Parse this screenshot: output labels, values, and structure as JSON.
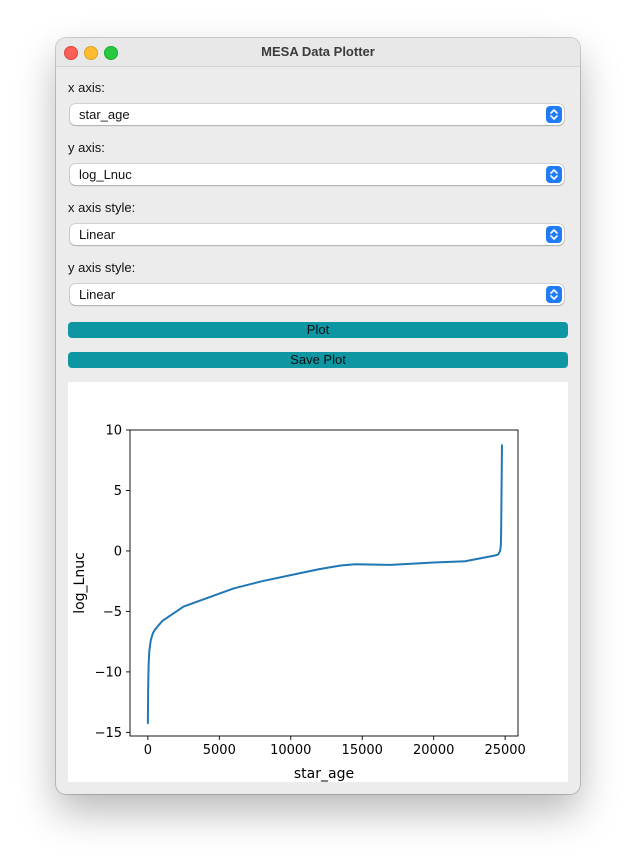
{
  "window": {
    "title": "MESA Data Plotter"
  },
  "controls": {
    "x_axis_label": "x axis:",
    "x_axis_value": "star_age",
    "y_axis_label": "y axis:",
    "y_axis_value": "log_Lnuc",
    "x_style_label": "x axis style:",
    "x_style_value": "Linear",
    "y_style_label": "y axis style:",
    "y_style_value": "Linear",
    "plot_button": "Plot",
    "save_button": "Save Plot"
  },
  "colors": {
    "accent": "#0e96a3",
    "line": "#1f77b4",
    "select_stepper": "#1f7cf5"
  },
  "chart_data": {
    "type": "line",
    "xlabel": "star_age",
    "ylabel": "log_Lnuc",
    "xlim": [
      -1250,
      25900
    ],
    "ylim": [
      -15.3,
      10
    ],
    "xticks": [
      0,
      5000,
      10000,
      15000,
      20000,
      25000
    ],
    "yticks": [
      -15,
      -10,
      -5,
      0,
      5,
      10
    ],
    "grid": false,
    "series": [
      {
        "x": [
          0,
          20,
          50,
          100,
          200,
          350,
          500,
          1000,
          2500,
          6000,
          8000,
          10000,
          12000,
          13500,
          14500,
          17000,
          20000,
          22200,
          24200,
          24500,
          24650,
          24700,
          24720,
          24740,
          24760,
          24780
        ],
        "y": [
          -14.3,
          -11.5,
          -9.5,
          -8.3,
          -7.4,
          -6.8,
          -6.5,
          -5.8,
          -4.6,
          -3.1,
          -2.5,
          -2.0,
          -1.5,
          -1.2,
          -1.1,
          -1.15,
          -0.95,
          -0.85,
          -0.4,
          -0.3,
          0.0,
          0.5,
          1.5,
          4.0,
          6.5,
          8.8
        ]
      }
    ]
  }
}
